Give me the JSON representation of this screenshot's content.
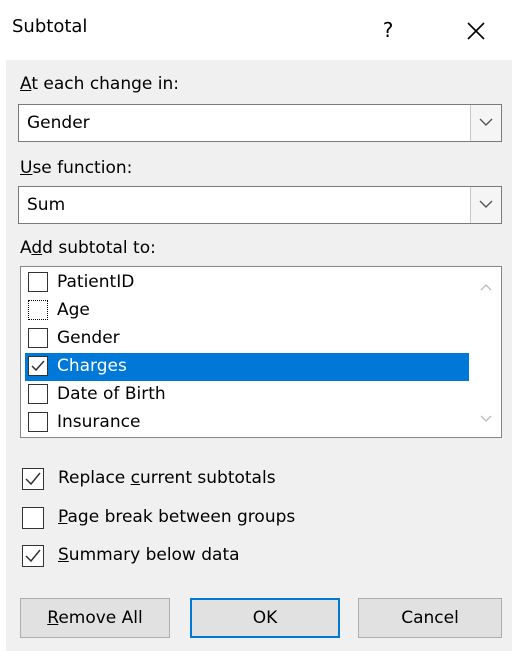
{
  "dialog": {
    "title": "Subtotal",
    "help_label": "?",
    "close_label": "✕"
  },
  "change_in": {
    "label_prefix": "",
    "label_access": "A",
    "label_rest": "t each change in:",
    "value": "Gender"
  },
  "use_function": {
    "label_access": "U",
    "label_rest": "se function:",
    "value": "Sum"
  },
  "add_subtotal": {
    "label_prefix": "A",
    "label_access": "d",
    "label_rest": "d subtotal to:",
    "items": [
      {
        "label": "PatientID",
        "checked": false,
        "selected": false
      },
      {
        "label": "Age",
        "checked": false,
        "selected": false
      },
      {
        "label": "Gender",
        "checked": false,
        "selected": false
      },
      {
        "label": "Charges",
        "checked": true,
        "selected": true
      },
      {
        "label": "Date of Birth",
        "checked": false,
        "selected": false
      },
      {
        "label": "Insurance",
        "checked": false,
        "selected": false
      }
    ]
  },
  "options": {
    "replace": {
      "prefix": "Replace ",
      "access": "c",
      "rest": "urrent subtotals",
      "checked": true
    },
    "page_break": {
      "prefix": "",
      "access": "P",
      "rest": "age break between groups",
      "checked": false
    },
    "summary": {
      "prefix": "",
      "access": "S",
      "rest": "ummary below data",
      "checked": true
    }
  },
  "buttons": {
    "remove_all_access": "R",
    "remove_all_rest": "emove All",
    "ok": "OK",
    "cancel": "Cancel"
  },
  "colors": {
    "selection": "#0078d7",
    "default_button_border": "#0078d7"
  }
}
